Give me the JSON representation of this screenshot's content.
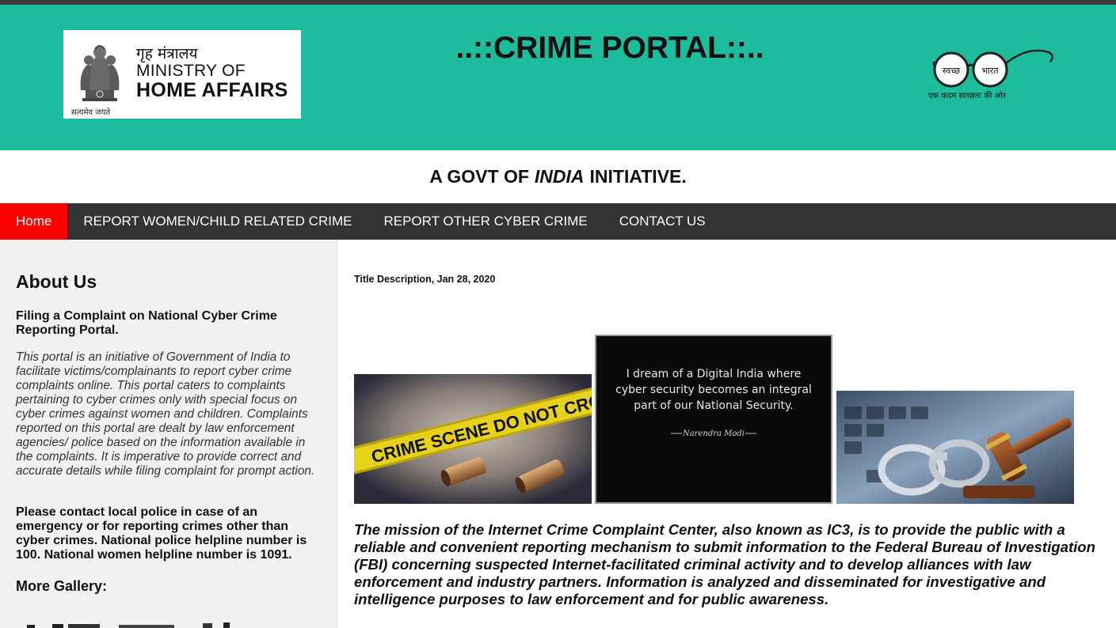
{
  "header": {
    "emblem_motto": "सत्यमेव जयते",
    "ministry_hindi": "गृह मंत्रालय",
    "ministry_line1": "MINISTRY OF",
    "ministry_line2": "HOME AFFAIRS",
    "site_title": "..::CRIME PORTAL::..",
    "swachh_left": "स्वच्छ",
    "swachh_right": "भारत",
    "swachh_tagline": "एक कदम स्वच्छता की ओर",
    "bg_color": "#1dbc9c"
  },
  "initiative": {
    "prefix": "A GOVT OF",
    "emphasis": "INDIA",
    "suffix": "INITIATIVE."
  },
  "nav": {
    "items": [
      {
        "label": "Home"
      },
      {
        "label": "REPORT WOMEN/CHILD RELATED CRIME"
      },
      {
        "label": "REPORT OTHER CYBER CRIME"
      },
      {
        "label": "CONTACT US"
      }
    ],
    "active_color": "#ff0000",
    "bg_color": "#333333"
  },
  "sidebar": {
    "about_heading": "About Us",
    "filing_heading": "Filing a Complaint on National Cyber Crime Reporting Portal.",
    "about_text": "This portal is an initiative of Government of India to facilitate victims/complainants to report cyber crime complaints online. This portal caters to complaints pertaining to cyber crimes only with special focus on cyber crimes against women and children. Complaints reported on this portal are dealt by law enforcement agencies/ police based on the information available in the complaints. It is imperative to provide correct and accurate details while filing complaint for prompt action.",
    "contact_text": "Please contact local police in case of an emergency or for reporting crimes other than cyber crimes. National police helpline number is 100. National women helpline number is 1091.",
    "gallery_heading": "More Gallery:"
  },
  "main": {
    "post_date": "Title Description, Jan 28, 2020",
    "gallery": {
      "img1_tape_text": "CRIME SCENE DO NOT CROSS",
      "quote_line1": "I dream of a Digital India where",
      "quote_line2": "cyber security becomes an integral",
      "quote_line3": "part of our National Security.",
      "quote_author": "Narendra Modi"
    },
    "mission_text": "The mission of the Internet Crime Complaint Center, also known as IC3, is to provide the public with a reliable and convenient reporting mechanism to submit information to the Federal Bureau of Investigation (FBI) concerning suspected Internet-facilitated criminal activity and to develop alliances with law enforcement and industry partners. Information is analyzed and disseminated for investigative and intelligence purposes to law enforcement and for public awareness."
  }
}
